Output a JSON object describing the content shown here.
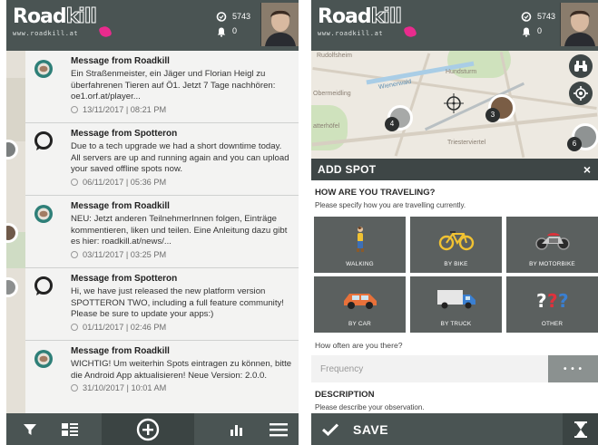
{
  "app": {
    "logo_text_solid": "Road",
    "logo_text_outline": "kill",
    "logo_url": "www.roadkill.at",
    "spots_count": "5743",
    "notifications_count": "0"
  },
  "messages": [
    {
      "sender": "Message from Roadkill",
      "body": "Ein Straßenmeister, ein Jäger und Florian Heigl zu überfahrenen Tieren auf Ö1. Jetzt 7 Tage nachhören: oe1.orf.at/player...",
      "time": "13/11/2017 | 08:21 PM",
      "badge": "roadkill-badge"
    },
    {
      "sender": "Message from Spotteron",
      "body": "Due to a tech upgrade we had a short downtime today. All servers are up and running again and you can upload your saved offline spots now.",
      "time": "06/11/2017 | 05:36 PM",
      "badge": "spotteron-badge"
    },
    {
      "sender": "Message from Roadkill",
      "body": "NEU: Jetzt anderen TeilnehmerInnen folgen, Einträge kommentieren, liken und teilen. Eine Anleitung dazu gibt es hier: roadkill.at/news/...",
      "time": "03/11/2017 | 03:25 PM",
      "badge": "roadkill-badge"
    },
    {
      "sender": "Message from Spotteron",
      "body": "Hi, we have just released the new platform version SPOTTERON TWO, including a full feature community! Please be sure to update your apps:)",
      "time": "01/11/2017 | 02:46 PM",
      "badge": "spotteron-badge"
    },
    {
      "sender": "Message from Roadkill",
      "body": "WICHTIG! Um weiterhin Spots eintragen zu können, bitte die Android App aktualisieren! Neue Version: 2.0.0.",
      "time": "31/10/2017 | 10:01 AM",
      "badge": "roadkill-badge"
    }
  ],
  "map_labels": {
    "top_left": "Rudolfsheim",
    "center": "Hundsturm",
    "left": "Obermeidling",
    "lower_left": "atterhöfel",
    "lower_right": "Triesterviertel",
    "small": "Wienerwald"
  },
  "clusters": [
    "4",
    "3",
    "6"
  ],
  "add_spot": {
    "title": "ADD SPOT",
    "close": "×",
    "traveling_title": "HOW ARE YOU TRAVELING?",
    "traveling_sub": "Please specify how you are travelling currently.",
    "modes": [
      {
        "label": "WALKING",
        "icon": "walking-person-icon"
      },
      {
        "label": "BY BIKE",
        "icon": "bicycle-icon"
      },
      {
        "label": "BY MOTORBIKE",
        "icon": "motorbike-icon"
      },
      {
        "label": "BY CAR",
        "icon": "car-icon"
      },
      {
        "label": "BY TRUCK",
        "icon": "truck-icon"
      },
      {
        "label": "OTHER",
        "icon": "question-marks-icon"
      }
    ],
    "frequency_question": "How often are you there?",
    "frequency_placeholder": "Frequency",
    "frequency_button": "• • •",
    "description_title": "DESCRIPTION",
    "description_sub": "Please describe your observation.",
    "save_label": "SAVE"
  },
  "colors": {
    "bar": "#4a5453",
    "bar_dark": "#3b4443",
    "tile": "#5b605f",
    "accent_pink": "#e92b8d",
    "roadkill_badge_teal": "#2e7f78"
  }
}
